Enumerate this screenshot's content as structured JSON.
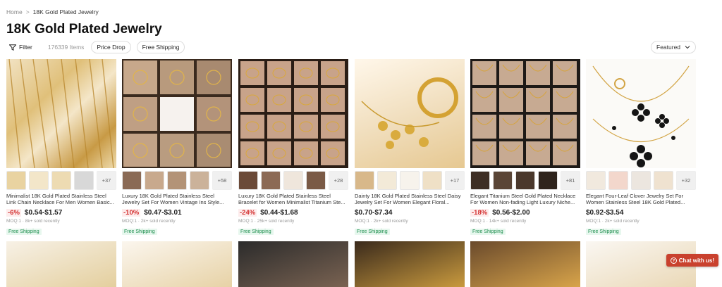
{
  "breadcrumb": {
    "home": "Home",
    "separator": ">",
    "current": "18K Gold Plated Jewelry"
  },
  "page": {
    "title": "18K Gold Plated Jewelry"
  },
  "filterbar": {
    "filter_label": "Filter",
    "items_count": "176339 Items",
    "chips": [
      "Price Drop",
      "Free Shipping"
    ]
  },
  "sort": {
    "label": "Featured"
  },
  "products": [
    {
      "title": "Minimalist 18K Gold Plated Stainless Steel Link Chain Necklace For Men Women Basic...",
      "discount": "-6%",
      "price": "$0.54-$1.57",
      "meta": "MOQ:1 · 8k+ sold recently",
      "shipping": "Free Shipping",
      "more": "+37"
    },
    {
      "title": "Luxury 18K Gold Plated Stainless Steel Jewelry Set For Women Vintage Ins Style...",
      "discount": "-10%",
      "price": "$0.47-$3.01",
      "meta": "MOQ:1 · 2k+ sold recently",
      "shipping": "Free Shipping",
      "more": "+58"
    },
    {
      "title": "Luxury 18K Gold Plated Stainless Steel Bracelet for Women Minimalist Titanium Ste...",
      "discount": "-24%",
      "price": "$0.44-$1.68",
      "meta": "MOQ:1 · 25k+ sold recently",
      "shipping": "Free Shipping",
      "more": "+28"
    },
    {
      "title": "Dainty 18K Gold Plated Stainless Steel Daisy Jewelry Set For Women Elegant Floral...",
      "discount": "",
      "price": "$0.70-$7.34",
      "meta": "MOQ:1 · 2k+ sold recently",
      "shipping": "Free Shipping",
      "more": "+17"
    },
    {
      "title": "Elegant Titanium Steel Gold Plated Necklace For Women Non-fading Light Luxury Niche...",
      "discount": "-18%",
      "price": "$0.56-$2.00",
      "meta": "MOQ:1 · 14k+ sold recently",
      "shipping": "Free Shipping",
      "more": "+81"
    },
    {
      "title": "Elegant Four-Leaf Clover Jewelry Set For Women Stainless Steel 18K Gold Plated...",
      "discount": "",
      "price": "$0.92-$3.54",
      "meta": "MOQ:1 · 2k+ sold recently",
      "shipping": "Free Shipping",
      "more": "+32"
    }
  ],
  "chat": {
    "label": "Chat with us!",
    "icon": "question-icon"
  },
  "colors": {
    "accent": "#c9412e",
    "gold": "#c9a45c",
    "discount": "#d32f2f",
    "ship": "#1e8e4e"
  }
}
